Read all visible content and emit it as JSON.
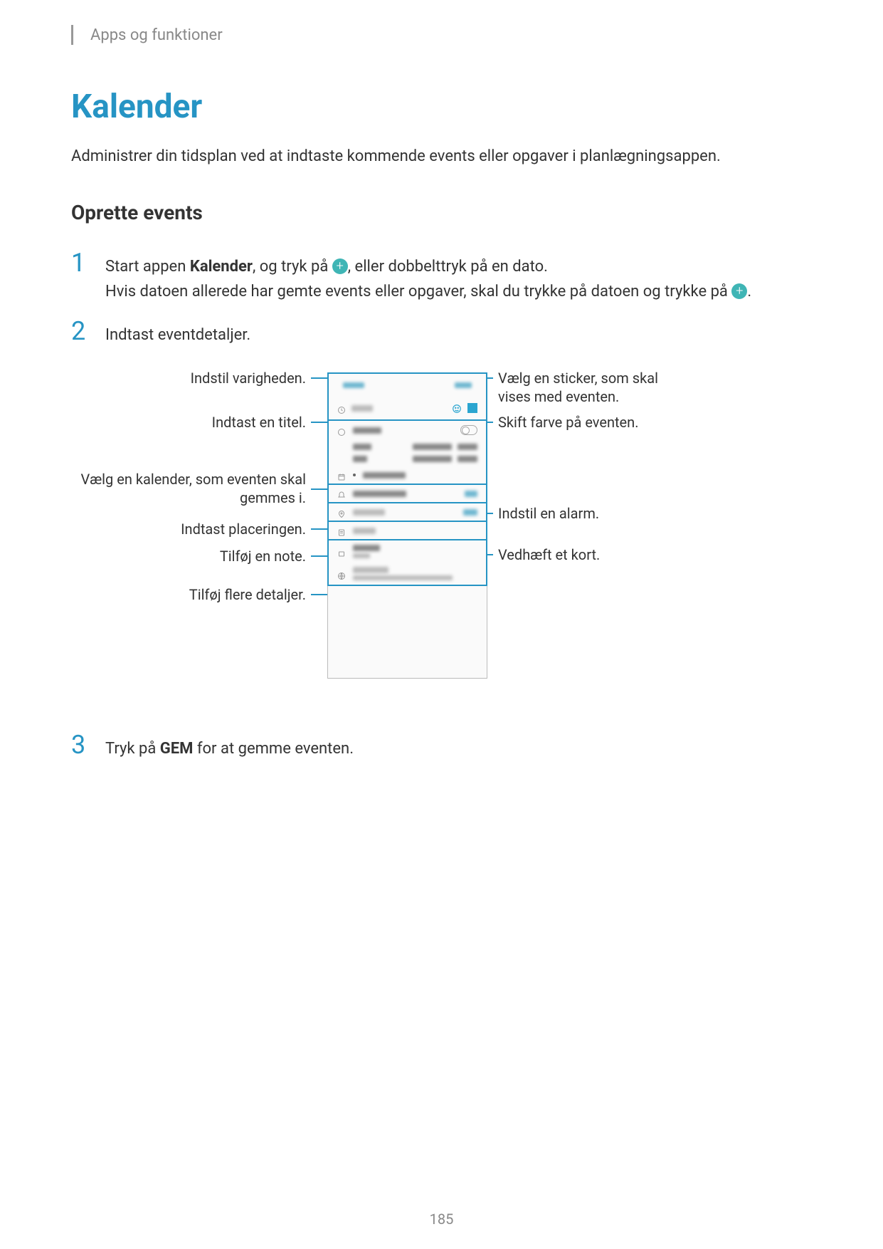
{
  "header": "Apps og funktioner",
  "title": "Kalender",
  "intro": "Administrer din tidsplan ved at indtaste kommende events eller opgaver i planlægningsappen.",
  "section_title": "Oprette events",
  "steps": {
    "1": {
      "num": "1",
      "part1": "Start appen ",
      "bold1": "Kalender",
      "part2": ", og tryk på ",
      "part3": ", eller dobbelttryk på en dato.",
      "line2": "Hvis datoen allerede har gemte events eller opgaver, skal du trykke på datoen og trykke på ",
      "line2_end": "."
    },
    "2": {
      "num": "2",
      "text": "Indtast eventdetaljer."
    },
    "3": {
      "num": "3",
      "part1": "Tryk på ",
      "bold1": "GEM",
      "part2": " for at gemme eventen."
    }
  },
  "callouts": {
    "duration": "Indstil varigheden.",
    "title_input": "Indtast en titel.",
    "calendar_select": "Vælg en kalender, som eventen skal gemmes i.",
    "location": "Indtast placeringen.",
    "note": "Tilføj en note.",
    "more_details": "Tilføj flere detaljer.",
    "sticker": "Vælg en sticker, som skal vises med eventen.",
    "color": "Skift farve på eventen.",
    "alarm": "Indstil en alarm.",
    "map": "Vedhæft et kort."
  },
  "page_number": "185"
}
